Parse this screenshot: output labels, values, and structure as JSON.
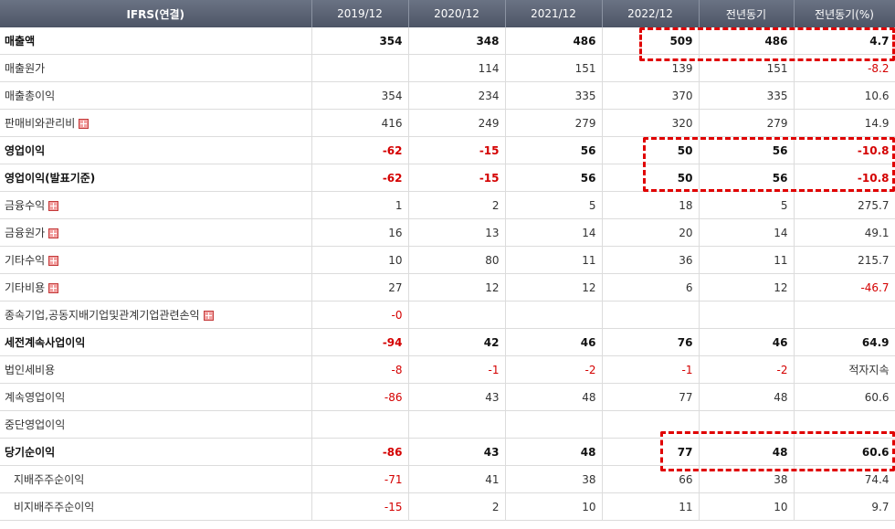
{
  "header": [
    "IFRS(연결)",
    "2019/12",
    "2020/12",
    "2021/12",
    "2022/12",
    "전년동기",
    "전년동기(%)"
  ],
  "rows": [
    {
      "label": "매출액",
      "values": [
        "354",
        "348",
        "486",
        "509",
        "486",
        "4.7"
      ],
      "bold": true,
      "plus": false
    },
    {
      "label": "매출원가",
      "values": [
        "",
        "114",
        "151",
        "139",
        "151",
        "-8.2"
      ],
      "bold": false,
      "plus": false
    },
    {
      "label": "매출총이익",
      "values": [
        "354",
        "234",
        "335",
        "370",
        "335",
        "10.6"
      ],
      "bold": false,
      "plus": false
    },
    {
      "label": "판매비와관리비",
      "values": [
        "416",
        "249",
        "279",
        "320",
        "279",
        "14.9"
      ],
      "bold": false,
      "plus": true
    },
    {
      "label": "영업이익",
      "values": [
        "-62",
        "-15",
        "56",
        "50",
        "56",
        "-10.8"
      ],
      "bold": true,
      "plus": false
    },
    {
      "label": "영업이익(발표기준)",
      "values": [
        "-62",
        "-15",
        "56",
        "50",
        "56",
        "-10.8"
      ],
      "bold": true,
      "plus": false
    },
    {
      "label": "금융수익",
      "values": [
        "1",
        "2",
        "5",
        "18",
        "5",
        "275.7"
      ],
      "bold": false,
      "plus": true
    },
    {
      "label": "금융원가",
      "values": [
        "16",
        "13",
        "14",
        "20",
        "14",
        "49.1"
      ],
      "bold": false,
      "plus": true
    },
    {
      "label": "기타수익",
      "values": [
        "10",
        "80",
        "11",
        "36",
        "11",
        "215.7"
      ],
      "bold": false,
      "plus": true
    },
    {
      "label": "기타비용",
      "values": [
        "27",
        "12",
        "12",
        "6",
        "12",
        "-46.7"
      ],
      "bold": false,
      "plus": true
    },
    {
      "label": "종속기업,공동지배기업및관계기업관련손익",
      "values": [
        "-0",
        "",
        "",
        "",
        "",
        ""
      ],
      "bold": false,
      "plus": true
    },
    {
      "label": "세전계속사업이익",
      "values": [
        "-94",
        "42",
        "46",
        "76",
        "46",
        "64.9"
      ],
      "bold": true,
      "plus": false
    },
    {
      "label": "법인세비용",
      "values": [
        "-8",
        "-1",
        "-2",
        "-1",
        "-2",
        "적자지속"
      ],
      "bold": false,
      "plus": false
    },
    {
      "label": "계속영업이익",
      "values": [
        "-86",
        "43",
        "48",
        "77",
        "48",
        "60.6"
      ],
      "bold": false,
      "plus": false
    },
    {
      "label": "중단영업이익",
      "values": [
        "",
        "",
        "",
        "",
        "",
        ""
      ],
      "bold": false,
      "plus": false
    },
    {
      "label": "당기순이익",
      "values": [
        "-86",
        "43",
        "48",
        "77",
        "48",
        "60.6"
      ],
      "bold": true,
      "plus": false
    },
    {
      "label": "지배주주순이익",
      "values": [
        "-71",
        "41",
        "38",
        "66",
        "38",
        "74.4"
      ],
      "bold": false,
      "plus": false,
      "indent": true
    },
    {
      "label": "비지배주주순이익",
      "values": [
        "-15",
        "2",
        "10",
        "11",
        "10",
        "9.7"
      ],
      "bold": false,
      "plus": false,
      "indent": true
    }
  ]
}
